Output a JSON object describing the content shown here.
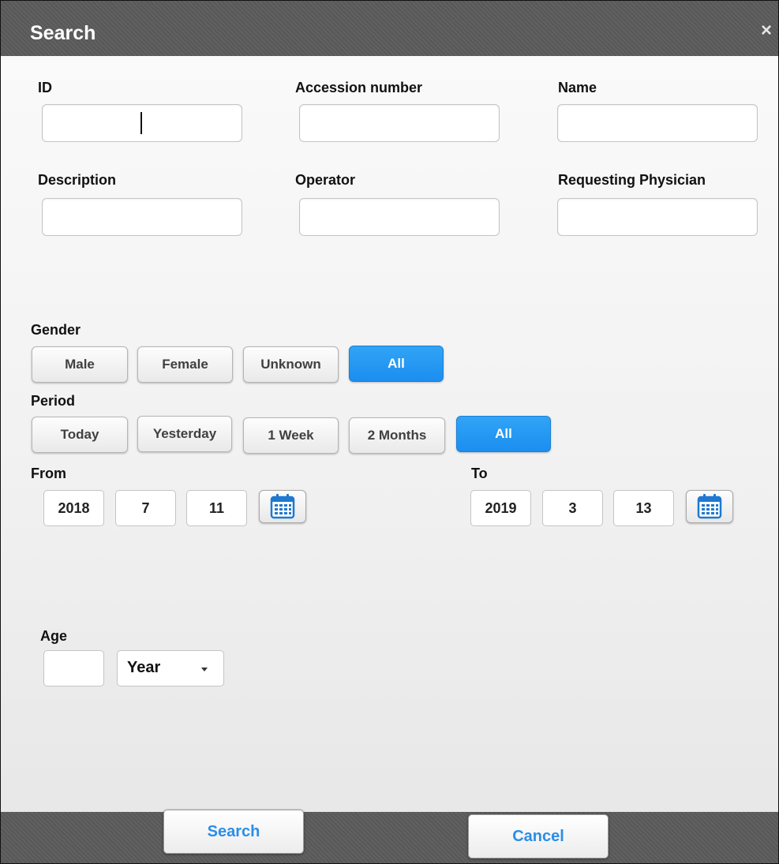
{
  "dialog": {
    "title": "Search",
    "close_symbol": "×",
    "close_icon": "close-icon"
  },
  "fields": {
    "id": {
      "label": "ID",
      "value": ""
    },
    "accession_number": {
      "label": "Accession number",
      "value": ""
    },
    "name": {
      "label": "Name",
      "value": ""
    },
    "description": {
      "label": "Description",
      "value": ""
    },
    "operator": {
      "label": "Operator",
      "value": ""
    },
    "requesting_physician": {
      "label": "Requesting Physician",
      "value": ""
    }
  },
  "gender": {
    "label": "Gender",
    "options": [
      "Male",
      "Female",
      "Unknown",
      "All"
    ],
    "selected": "All"
  },
  "period": {
    "label": "Period",
    "options": [
      "Today",
      "Yesterday",
      "1 Week",
      "2 Months",
      "All"
    ],
    "selected": "All"
  },
  "from": {
    "label": "From",
    "year": "2018",
    "month": "7",
    "day": "11",
    "calendar_icon": "calendar-icon"
  },
  "to": {
    "label": "To",
    "year": "2019",
    "month": "3",
    "day": "13",
    "calendar_icon": "calendar-icon"
  },
  "age": {
    "label": "Age",
    "value": "",
    "unit": "Year",
    "dropdown_icon": "caret-down-icon"
  },
  "footer": {
    "search_label": "Search",
    "cancel_label": "Cancel"
  },
  "colors": {
    "accent": "#1e90f2",
    "bar": "#5b5b5b",
    "link_text": "#2a8ee8"
  }
}
